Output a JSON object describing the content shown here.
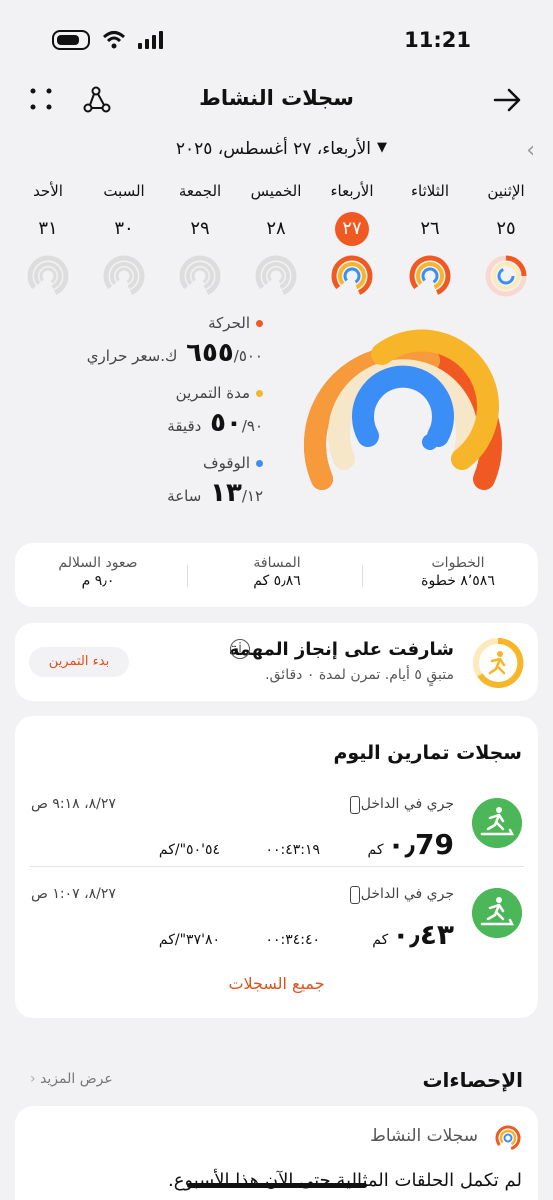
{
  "status_bar": {
    "time": "11:21"
  },
  "header": {
    "title": "سجلات النشاط"
  },
  "date": {
    "label": "الأربعاء، ٢٧ أغسطس، ٢٠٢٥"
  },
  "week": [
    {
      "name": "الإثنين",
      "num": "٢٥",
      "selected": false
    },
    {
      "name": "الثلاثاء",
      "num": "٢٦",
      "selected": false
    },
    {
      "name": "الأربعاء",
      "num": "٢٧",
      "selected": true
    },
    {
      "name": "الخميس",
      "num": "٢٨",
      "selected": false
    },
    {
      "name": "الجمعة",
      "num": "٢٩",
      "selected": false
    },
    {
      "name": "السبت",
      "num": "٣٠",
      "selected": false
    },
    {
      "name": "الأحد",
      "num": "٣١",
      "selected": false
    }
  ],
  "metrics": {
    "move": {
      "label": "الحركة",
      "value": "٦٥٥",
      "goal": "/٥٠٠ ك.سعر حراري",
      "color": "#f05a22"
    },
    "exercise": {
      "label": "مدة التمرين",
      "value": "٥٠",
      "goal": "/٩٠ دقيقة",
      "color": "#f7b529"
    },
    "stand": {
      "label": "الوقوف",
      "value": "١٣",
      "goal": "/١٢ ساعة",
      "color": "#3a8ef6"
    }
  },
  "stats": [
    {
      "label": "الخطوات",
      "value": "٨٬٥٨٦ خطوة"
    },
    {
      "label": "المسافة",
      "value": "٥٫٨٦ كم"
    },
    {
      "label": "صعود السلالم",
      "value": "٩٫٠ م"
    }
  ],
  "task": {
    "title": "شارفت على إنجاز المهمة",
    "subtitle": "متبقٍ ٥ أيام. تمرن لمدة ٠ دقائق.",
    "button": "بدء التمرين",
    "info": "i"
  },
  "workouts": {
    "title": "سجلات تمارين اليوم",
    "items": [
      {
        "name": "جري في الداخل",
        "date": "٨/٢٧، ٩:١٨ ص",
        "distance": "٠٫79",
        "unit": "كم",
        "time": "٠٠:٤٣:١٩",
        "pace": "٥٤'٥٠\"/كم"
      },
      {
        "name": "جري في الداخل",
        "date": "٨/٢٧، ١:٠٧ ص",
        "distance": "٠٫٤٣",
        "unit": "كم",
        "time": "٠٠:٣٤:٤٠",
        "pace": "٨٠'٣٧\"/كم"
      }
    ],
    "all_link": "جميع السجلات"
  },
  "statistics": {
    "title": "الإحصاءات",
    "more": "عرض المزيد",
    "card_title": "سجلات النشاط",
    "card_text": "لم تكمل الحلقات المثالية حتى الآن هذا الأسبوع."
  }
}
